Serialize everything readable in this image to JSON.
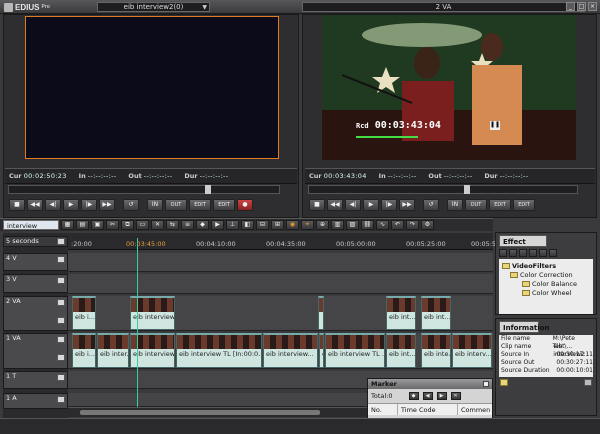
{
  "app": {
    "name": "EDIUS",
    "edition": "Pro"
  },
  "titlebar": {
    "sequence_selector": "eib interview2(0)",
    "window_mode": "2 VA"
  },
  "player": {
    "cur_label": "Cur",
    "cur_tc": "00:02:50:23",
    "in_label": "In",
    "in_tc": "--:--:--:--",
    "out_label": "Out",
    "out_tc": "--:--:--:--",
    "dur_label": "Dur",
    "dur_tc": "--:--:--:--"
  },
  "recorder": {
    "overlay_label": "Rcd",
    "overlay_tc": "00:03:43:04",
    "cur_label": "Cur",
    "cur_tc": "00:03:43:04",
    "in_label": "In",
    "in_tc": "--:--:--:--",
    "out_label": "Out",
    "out_tc": "--:--:--:--",
    "dur_label": "Dur",
    "dur_tc": "--:--:--:--"
  },
  "player_controls": [
    "■",
    "◀◀",
    "◀|",
    "▶",
    "|▶",
    "▶▶",
    "↺",
    "IN",
    "OUT",
    "EDIT",
    "EDIT",
    "●"
  ],
  "recorder_controls": [
    "■",
    "◀◀",
    "◀|",
    "▶",
    "|▶",
    "▶▶",
    "↺",
    "IN",
    "OUT",
    "EDIT",
    "EDIT"
  ],
  "timeline": {
    "sequence_tab": "interview",
    "scale": "5 seconds",
    "ruler_ticks": [
      ":20:00",
      "00:03:45:00",
      "00:04:10:00",
      "00:04:35:00",
      "00:05:00:00",
      "00:05:25:00",
      "00:05:50"
    ],
    "tracks": [
      {
        "name": "4 V"
      },
      {
        "name": "3 V"
      },
      {
        "name": "2 VA"
      },
      {
        "name": "1 VA"
      },
      {
        "name": "1 T"
      },
      {
        "name": "1 A"
      }
    ],
    "track_2va_clips": [
      "eib i...",
      "eib interview...",
      "",
      "eib int...",
      "eib int..."
    ],
    "track_1va_clips": [
      "eib i...",
      "eib inter...",
      "eib interview",
      "eib interview TL [In:00:0...",
      "eib interview...",
      "eib Interview T...",
      "eib interview TL ...",
      "eib int...",
      "eib inte...",
      "eib interv..."
    ]
  },
  "effect_panel": {
    "tab": "Effect",
    "tree": [
      {
        "label": "VideoFilters",
        "bold": true
      },
      {
        "label": "Color Correction"
      },
      {
        "label": "Color Balance"
      },
      {
        "label": "Color Wheel"
      }
    ]
  },
  "information_panel": {
    "tab": "Information",
    "rows": [
      {
        "key": "File name",
        "value": "M:\\Pete Test\\..."
      },
      {
        "key": "Clip name",
        "value": "eib interview2"
      },
      {
        "key": "Source In",
        "value": "00:30:17:11"
      },
      {
        "key": "Source Out",
        "value": "00:30:27:11"
      },
      {
        "key": "Source Duration",
        "value": "00:00:10:01"
      }
    ]
  },
  "marker_panel": {
    "title": "Marker",
    "total": "Total:0",
    "columns": [
      "No.",
      "Time Code",
      "Commen"
    ]
  }
}
